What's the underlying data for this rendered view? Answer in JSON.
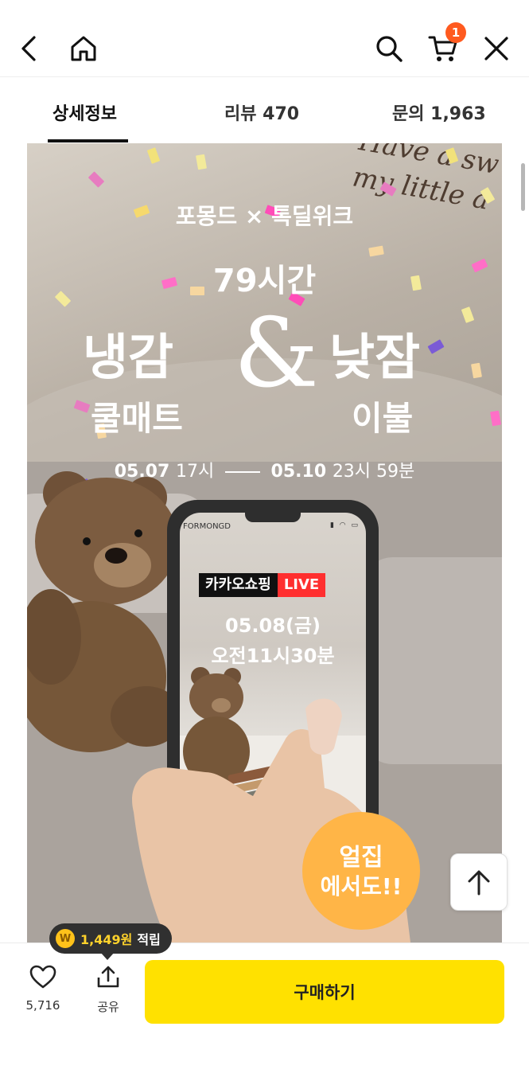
{
  "header": {
    "cart_count": "1",
    "icons": [
      "back-arrow-icon",
      "home-icon",
      "search-icon",
      "cart-icon",
      "close-icon"
    ]
  },
  "tabs": [
    {
      "label": "상세정보",
      "active": true
    },
    {
      "label": "리뷰 470",
      "active": false
    },
    {
      "label": "문의 1,963",
      "active": false
    }
  ],
  "banner": {
    "wall_text_1": "Have a sw",
    "wall_text_2": "my little a",
    "collab": "포몽드 × 톡딜위크",
    "hours": "79시간",
    "left_big": "냉감",
    "left_small": "쿨매트",
    "ampersand": "&",
    "right_big": "낮잠",
    "right_small": "이불",
    "period_start_date": "05.07",
    "period_start_time": "17시",
    "period_end_date": "05.10",
    "period_end_time": "23시 59분",
    "phone": {
      "brand": "FORMONGD",
      "live_brand": "카카오쇼핑",
      "live_tag": "LIVE",
      "date": "05.08(금)",
      "time": "오전11시30분"
    },
    "bubble_line1": "얼집",
    "bubble_line2": "에서도!!"
  },
  "reward": {
    "coin_symbol": "W",
    "amount": "1,449원",
    "label": "적립"
  },
  "actions": {
    "like_count": "5,716",
    "share_label": "공유",
    "buy_label": "구매하기"
  },
  "colors": {
    "buy_button": "#ffe100",
    "cart_badge": "#ff5a1f",
    "live_tag": "#ff2f2f",
    "reward_amount": "#ffd22b"
  }
}
